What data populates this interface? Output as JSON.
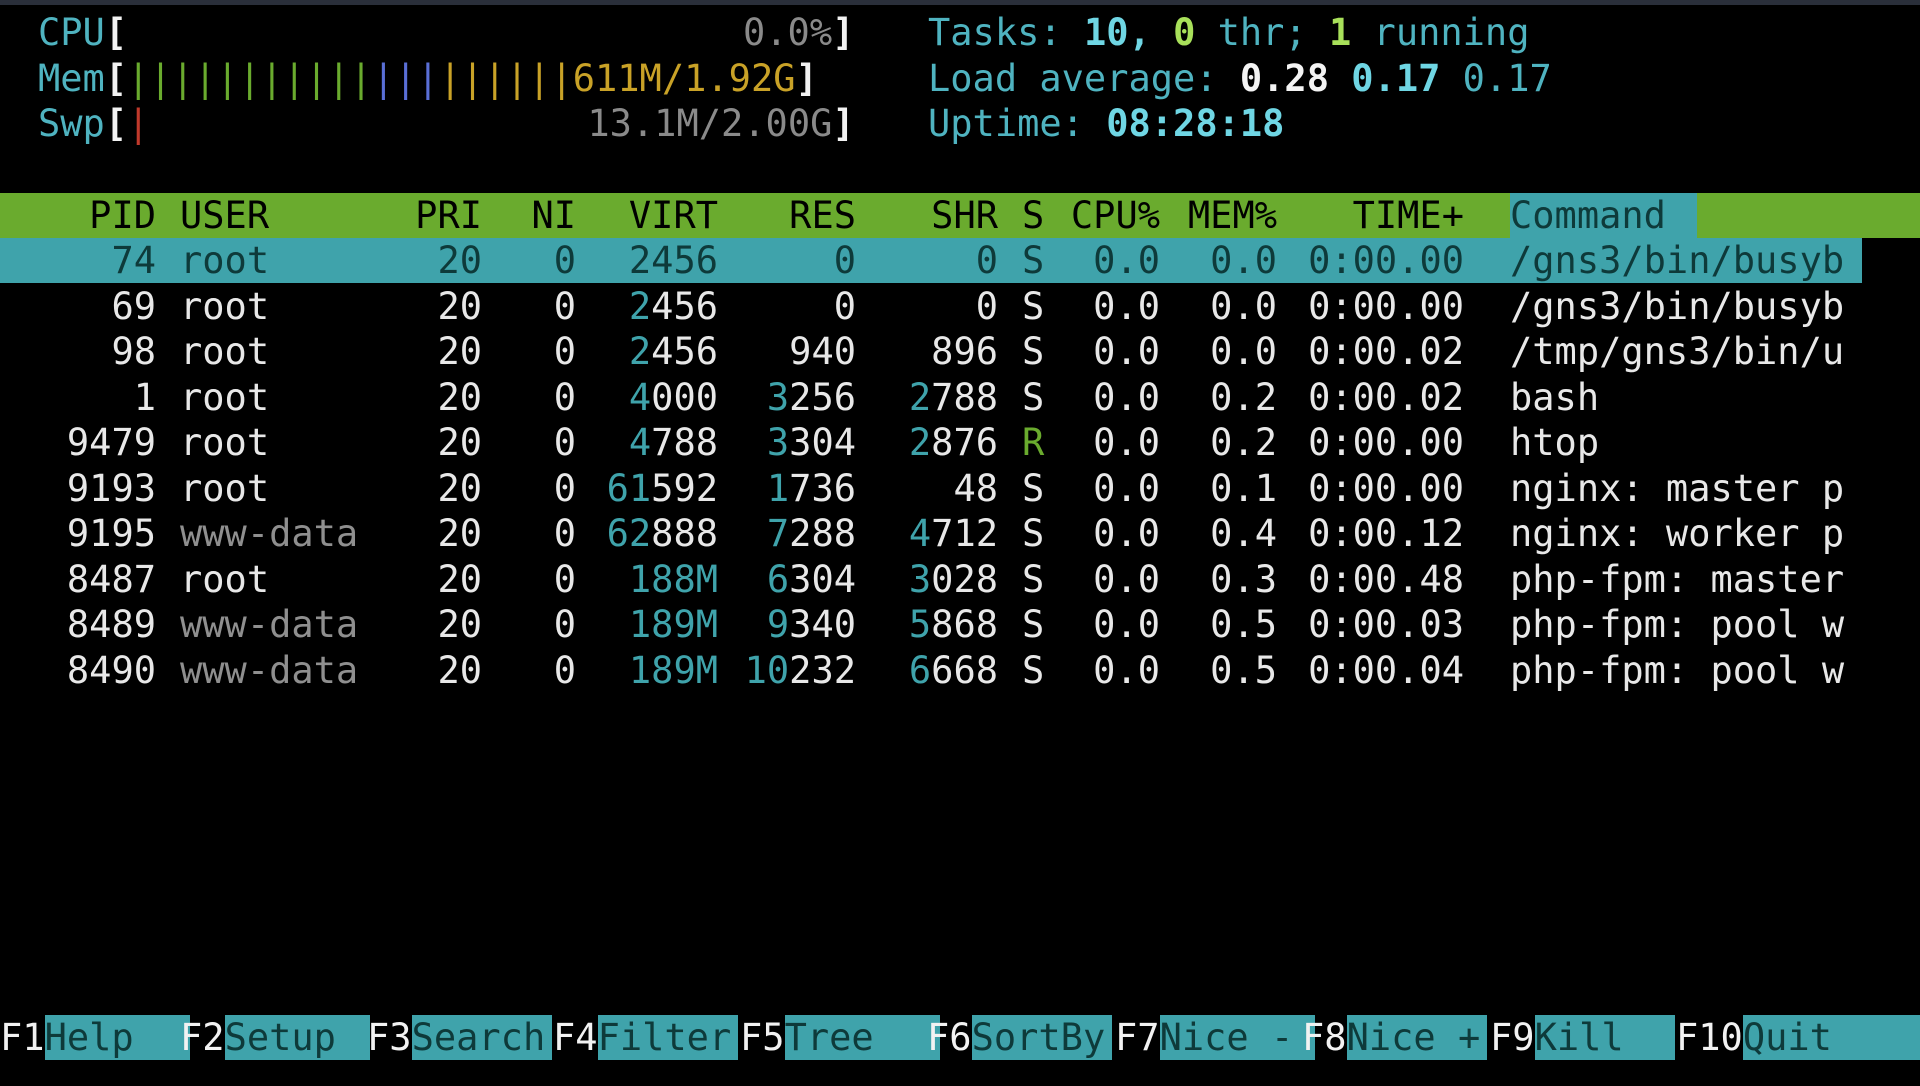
{
  "meters": {
    "cpu": {
      "label": "CPU",
      "value": "0.0%",
      "percent": 0.0
    },
    "mem": {
      "label": "Mem",
      "bars": "||||||||||||||||||||",
      "value": "611M/1.92G"
    },
    "swp": {
      "label": "Swp",
      "bars": "|",
      "value": "13.1M/2.00G"
    }
  },
  "summary": {
    "tasks_label": "Tasks: ",
    "tasks": "10",
    "comma": ", ",
    "thr": "0",
    "thr_label": " thr; ",
    "running": "1",
    "running_label": " running",
    "load_label": "Load average: ",
    "load1": "0.28",
    "load5": "0.17",
    "load15": "0.17",
    "uptime_label": "Uptime: ",
    "uptime": "08:28:18"
  },
  "columns": [
    "PID",
    "USER",
    "PRI",
    "NI",
    "VIRT",
    "RES",
    "SHR",
    "S",
    "CPU%",
    "MEM%",
    "TIME+",
    "Command"
  ],
  "processes": [
    {
      "pid": "74",
      "user": "root",
      "pri": "20",
      "ni": "0",
      "virt": "2456",
      "res": "0",
      "shr": "0",
      "s": "S",
      "cpu": "0.0",
      "mem": "0.0",
      "time": "0:00.00",
      "cmd": "/gns3/bin/busyb",
      "selected": true
    },
    {
      "pid": "69",
      "user": "root",
      "pri": "20",
      "ni": "0",
      "virt": "2456",
      "res": "0",
      "shr": "0",
      "s": "S",
      "cpu": "0.0",
      "mem": "0.0",
      "time": "0:00.00",
      "cmd": "/gns3/bin/busyb"
    },
    {
      "pid": "98",
      "user": "root",
      "pri": "20",
      "ni": "0",
      "virt": "2456",
      "res": "940",
      "shr": "896",
      "s": "S",
      "cpu": "0.0",
      "mem": "0.0",
      "time": "0:00.02",
      "cmd": "/tmp/gns3/bin/u"
    },
    {
      "pid": "1",
      "user": "root",
      "pri": "20",
      "ni": "0",
      "virt": "4000",
      "res": "3256",
      "shr": "2788",
      "s": "S",
      "cpu": "0.0",
      "mem": "0.2",
      "time": "0:00.02",
      "cmd": "bash"
    },
    {
      "pid": "9479",
      "user": "root",
      "pri": "20",
      "ni": "0",
      "virt": "4788",
      "res": "3304",
      "shr": "2876",
      "s": "R",
      "cpu": "0.0",
      "mem": "0.2",
      "time": "0:00.00",
      "cmd": "htop"
    },
    {
      "pid": "9193",
      "user": "root",
      "pri": "20",
      "ni": "0",
      "virt": "61592",
      "res": "1736",
      "shr": "48",
      "s": "S",
      "cpu": "0.0",
      "mem": "0.1",
      "time": "0:00.00",
      "cmd": "nginx: master p"
    },
    {
      "pid": "9195",
      "user": "www-data",
      "pri": "20",
      "ni": "0",
      "virt": "62888",
      "res": "7288",
      "shr": "4712",
      "s": "S",
      "cpu": "0.0",
      "mem": "0.4",
      "time": "0:00.12",
      "cmd": "nginx: worker p"
    },
    {
      "pid": "8487",
      "user": "root",
      "pri": "20",
      "ni": "0",
      "virt": "188M",
      "res": "6304",
      "shr": "3028",
      "s": "S",
      "cpu": "0.0",
      "mem": "0.3",
      "time": "0:00.48",
      "cmd": "php-fpm: master"
    },
    {
      "pid": "8489",
      "user": "www-data",
      "pri": "20",
      "ni": "0",
      "virt": "189M",
      "res": "9340",
      "shr": "5868",
      "s": "S",
      "cpu": "0.0",
      "mem": "0.5",
      "time": "0:00.03",
      "cmd": "php-fpm: pool w"
    },
    {
      "pid": "8490",
      "user": "www-data",
      "pri": "20",
      "ni": "0",
      "virt": "189M",
      "res": "10232",
      "shr": "6668",
      "s": "S",
      "cpu": "0.0",
      "mem": "0.5",
      "time": "0:00.04",
      "cmd": "php-fpm: pool w"
    }
  ],
  "fkeys": [
    {
      "key": "F1",
      "label": "Help"
    },
    {
      "key": "F2",
      "label": "Setup"
    },
    {
      "key": "F3",
      "label": "Search"
    },
    {
      "key": "F4",
      "label": "Filter"
    },
    {
      "key": "F5",
      "label": "Tree"
    },
    {
      "key": "F6",
      "label": "SortBy"
    },
    {
      "key": "F7",
      "label": "Nice -"
    },
    {
      "key": "F8",
      "label": "Nice +"
    },
    {
      "key": "F9",
      "label": "Kill"
    },
    {
      "key": "F10",
      "label": "Quit"
    }
  ],
  "colors": {
    "header_bg": "#6aab2e",
    "accent": "#3fa3ab",
    "mem_value": "#c9a227"
  }
}
